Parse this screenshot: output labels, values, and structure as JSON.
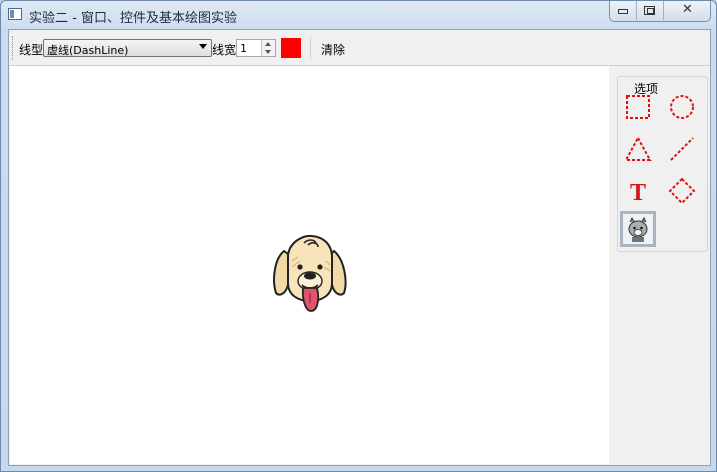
{
  "window": {
    "title": "实验二 - 窗口、控件及基本绘图实验"
  },
  "toolbar": {
    "line_style_label": "线型",
    "line_style_value": "虚线(DashLine)",
    "line_width_label": "线宽",
    "line_width_value": "1",
    "color": "#ff0000",
    "clear_label": "清除"
  },
  "panel": {
    "group_title": "选项",
    "tools": [
      {
        "icon": "dashed-rectangle-icon"
      },
      {
        "icon": "dashed-ellipse-icon"
      },
      {
        "icon": "dashed-triangle-icon"
      },
      {
        "icon": "dashed-line-icon"
      },
      {
        "icon": "text-icon",
        "glyph": "T"
      },
      {
        "icon": "dashed-diamond-icon"
      },
      {
        "icon": "image-icon",
        "selected": true
      }
    ]
  },
  "canvas": {
    "content": "dog-cartoon-image"
  },
  "colors": {
    "shape_red": "#e01010",
    "panel_bg": "#f0f0f0"
  }
}
